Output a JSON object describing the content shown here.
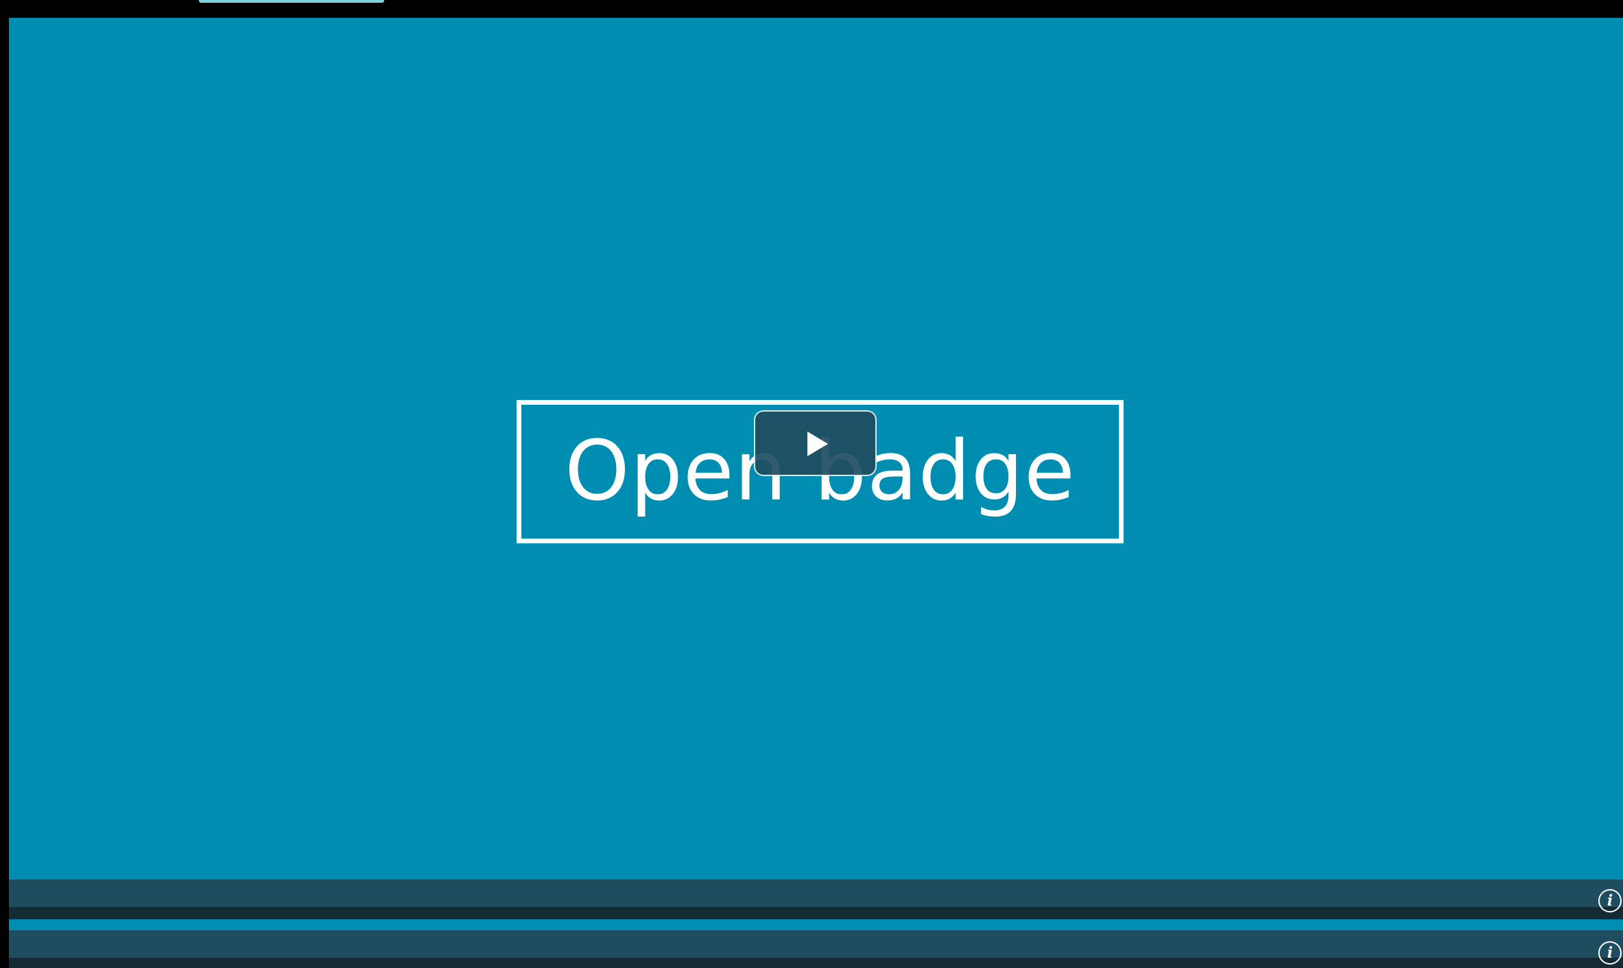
{
  "video": {
    "title": "Open badge",
    "play_icon": "play-icon",
    "colors": {
      "background": "#008db2",
      "title_text": "#ffffff",
      "play_button": "#1f4d60",
      "control_bar": "#1f4d60"
    }
  },
  "controls": {
    "info_icon_glyph": "i",
    "info_icon_name": "info-icon"
  }
}
